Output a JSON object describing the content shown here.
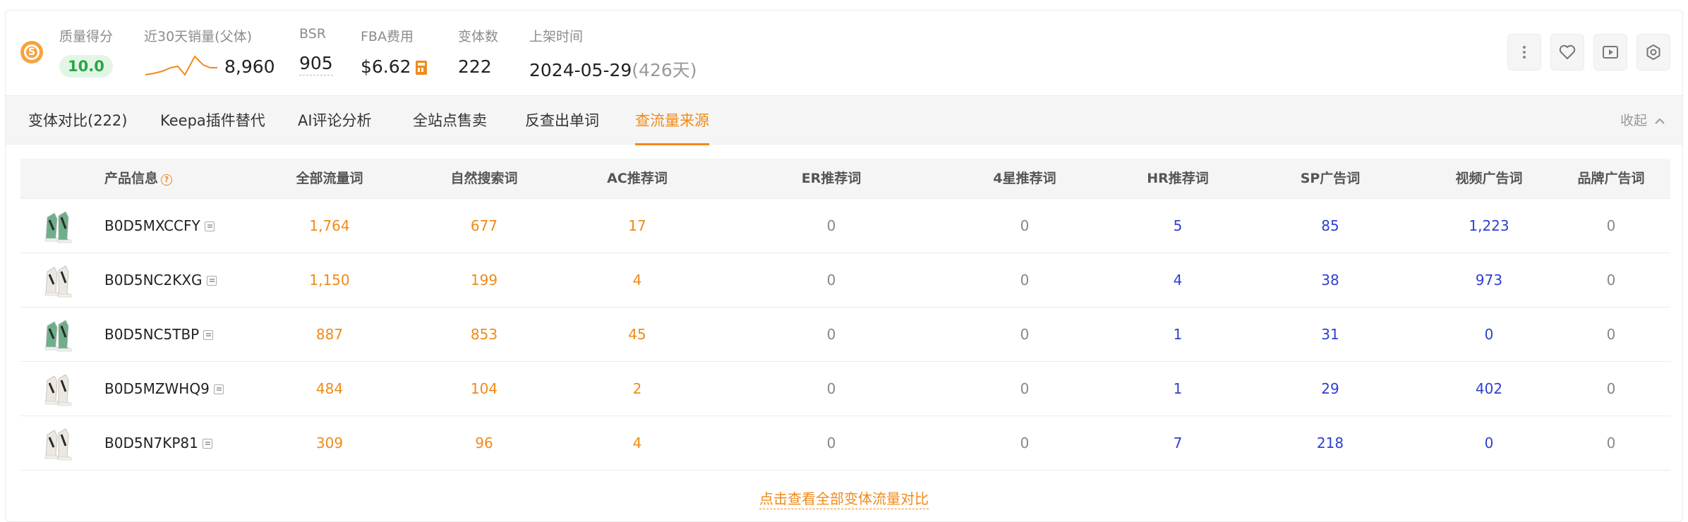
{
  "header": {
    "quality": {
      "label": "质量得分",
      "value": "10.0"
    },
    "sales": {
      "label": "近30天销量(父体)",
      "value": "8,960"
    },
    "bsr": {
      "label": "BSR",
      "value": "905"
    },
    "fba": {
      "label": "FBA费用",
      "value": "$6.62"
    },
    "variants": {
      "label": "变体数",
      "value": "222"
    },
    "listed": {
      "label": "上架时间",
      "date": "2024-05-29",
      "days": "(426天)"
    }
  },
  "icons": [
    "more-vertical-icon",
    "heart-icon",
    "play-icon",
    "settings-icon"
  ],
  "tabs": [
    {
      "label": "变体对比(222)"
    },
    {
      "label": "Keepa插件替代"
    },
    {
      "label": "AI评论分析"
    },
    {
      "label": "全站点售卖"
    },
    {
      "label": "反查出单词"
    },
    {
      "label": "查流量来源"
    }
  ],
  "active_tab": "查流量来源",
  "collapse_label": "收起",
  "table": {
    "columns": [
      "产品信息",
      "全部流量词",
      "自然搜索词",
      "AC推荐词",
      "ER推荐词",
      "4星推荐词",
      "HR推荐词",
      "SP广告词",
      "视频广告词",
      "品牌广告词"
    ],
    "rows": [
      {
        "thumb": "green",
        "asin": "B0D5MXCCFY",
        "values": [
          "1,764",
          "677",
          "17",
          "0",
          "0",
          "5",
          "85",
          "1,223",
          "0"
        ]
      },
      {
        "thumb": "white",
        "asin": "B0D5NC2KXG",
        "values": [
          "1,150",
          "199",
          "4",
          "0",
          "0",
          "4",
          "38",
          "973",
          "0"
        ]
      },
      {
        "thumb": "green",
        "asin": "B0D5NC5TBP",
        "values": [
          "887",
          "853",
          "45",
          "0",
          "0",
          "1",
          "31",
          "0",
          "0"
        ]
      },
      {
        "thumb": "white",
        "asin": "B0D5MZWHQ9",
        "values": [
          "484",
          "104",
          "2",
          "0",
          "0",
          "1",
          "29",
          "402",
          "0"
        ]
      },
      {
        "thumb": "white",
        "asin": "B0D5N7KP81",
        "values": [
          "309",
          "96",
          "4",
          "0",
          "0",
          "7",
          "218",
          "0",
          "0"
        ]
      }
    ]
  },
  "footer_link": "点击查看全部变体流量对比",
  "colors": {
    "accent": "#f08a18",
    "blue": "#2f3fd1",
    "green": "#2aa745"
  }
}
